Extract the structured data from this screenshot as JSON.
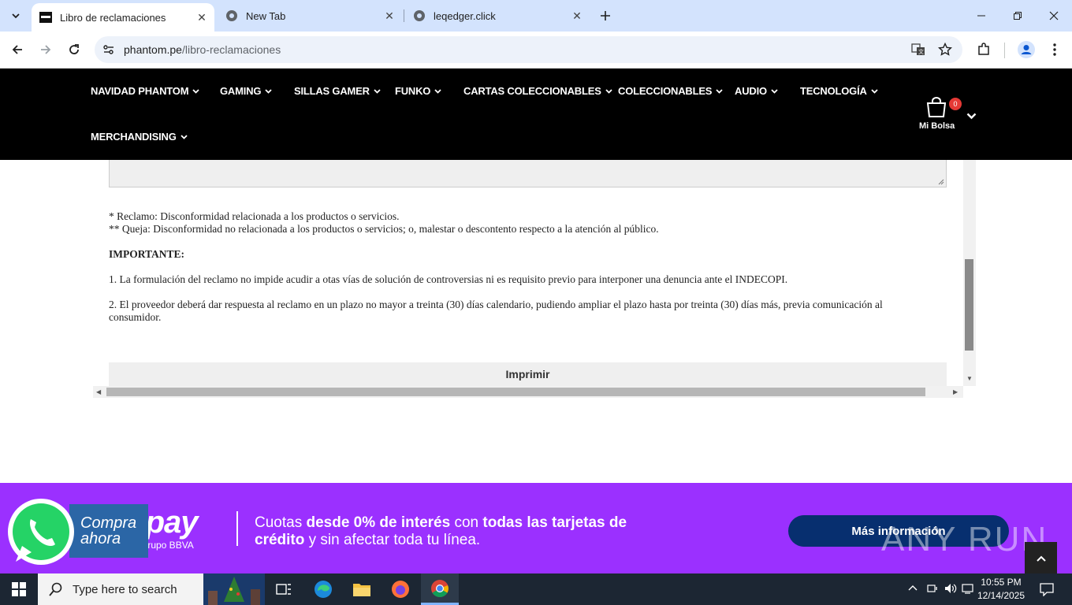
{
  "browser": {
    "tabs": [
      {
        "title": "Libro de reclamaciones",
        "active": true
      },
      {
        "title": "New Tab",
        "active": false
      },
      {
        "title": "leqedger.click",
        "active": false
      }
    ],
    "url": {
      "host": "phantom.pe",
      "path": "/libro-reclamaciones"
    }
  },
  "site": {
    "menu": [
      "NAVIDAD PHANTOM",
      "GAMING",
      "SILLAS GAMER",
      "FUNKO",
      "CARTAS COLECCIONABLES",
      "COLECCIONABLES",
      "AUDIO",
      "TECNOLOGÍA",
      "MERCHANDISING"
    ],
    "bag": {
      "label": "Mi Bolsa",
      "count": "0"
    }
  },
  "content": {
    "note1": "* Reclamo: Disconformidad relacionada a los productos o servicios.",
    "note2": "** Queja: Disconformidad no relacionada a los productos o servicios; o, malestar o descontento respecto a la atención al público.",
    "important_title": "IMPORTANTE:",
    "point1": "1. La formulación del reclamo no impide acudir a otas vías de solución de controversias ni es requisito previo para interponer una denuncia ante el INDECOPI.",
    "point2_line1": "2. El proveedor deberá dar respuesta al reclamo en un plazo no mayor a treinta (30) días calendario, pudiendo ampliar el plazo hasta por treinta (30) días más, previa comunicación al",
    "point2_line2": "consumidor.",
    "print_button": "Imprimir"
  },
  "promo": {
    "logo": "rpay",
    "sub": "l Grupo BBVA",
    "compra": "Compra ahora",
    "text_a": "Cuotas ",
    "text_b": "desde 0% de interés",
    "text_c": " con ",
    "text_d": "todas las tarjetas de crédito",
    "text_e": " y sin afectar toda tu línea.",
    "button": "Más información",
    "watermark": "ANY RUN"
  },
  "taskbar": {
    "search_placeholder": "Type here to search",
    "time": "10:55 PM",
    "date": "12/14/2025"
  },
  "colors": {
    "tabstrip": "#d3e3fd",
    "header": "#000000",
    "promo": "#9b30ff",
    "promo_button": "#072f6f",
    "taskbar": "#1c2633"
  }
}
